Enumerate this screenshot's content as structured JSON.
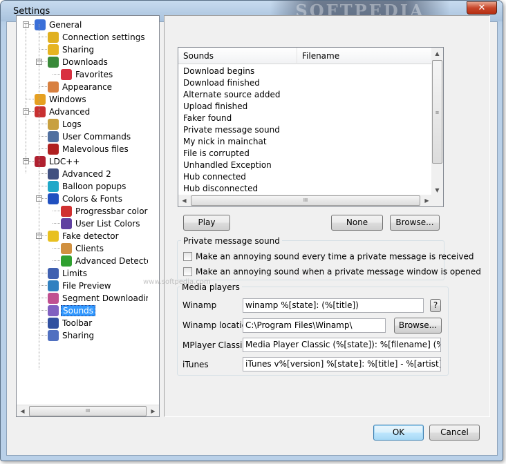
{
  "window": {
    "title": "Settings",
    "close_glyph": "✕",
    "watermark": "SOFTPEDIA"
  },
  "tree": {
    "items": [
      {
        "label": "General",
        "icon": "general-icon",
        "color": "#3a6fd8"
      },
      {
        "label": "Connection settings",
        "icon": "connection-icon",
        "color": "#e0b020"
      },
      {
        "label": "Sharing",
        "icon": "sharing-icon",
        "color": "#e6b422"
      },
      {
        "label": "Downloads",
        "icon": "downloads-icon",
        "color": "#3a8a3a"
      },
      {
        "label": "Favorites",
        "icon": "favorites-icon",
        "color": "#d83040"
      },
      {
        "label": "Appearance",
        "icon": "appearance-icon",
        "color": "#d88040"
      },
      {
        "label": "Windows",
        "icon": "windows-icon",
        "color": "#e6a020"
      },
      {
        "label": "Advanced",
        "icon": "advanced-icon",
        "color": "#c83030"
      },
      {
        "label": "Logs",
        "icon": "logs-icon",
        "color": "#c8a040"
      },
      {
        "label": "User Commands",
        "icon": "user-commands-icon",
        "color": "#5070a0"
      },
      {
        "label": "Malevolous files",
        "icon": "malevolous-files-icon",
        "color": "#b02020"
      },
      {
        "label": "LDC++",
        "icon": "ldc-icon",
        "color": "#b02030"
      },
      {
        "label": "Advanced 2",
        "icon": "advanced2-icon",
        "color": "#405080"
      },
      {
        "label": "Balloon popups",
        "icon": "balloon-icon",
        "color": "#20a8c8"
      },
      {
        "label": "Colors & Fonts",
        "icon": "colors-fonts-icon",
        "color": "#2050c0"
      },
      {
        "label": "Progressbar colors",
        "icon": "progressbar-icon",
        "color": "#d03030"
      },
      {
        "label": "User List Colors",
        "icon": "user-list-colors-icon",
        "color": "#6040a0"
      },
      {
        "label": "Fake detector",
        "icon": "warning-icon",
        "color": "#e8c020"
      },
      {
        "label": "Clients",
        "icon": "clients-icon",
        "color": "#d09040"
      },
      {
        "label": "Advanced Detector Pat",
        "icon": "detector-icon",
        "color": "#30a030"
      },
      {
        "label": "Limits",
        "icon": "limits-icon",
        "color": "#4060b0"
      },
      {
        "label": "File Preview",
        "icon": "file-preview-icon",
        "color": "#3080c0"
      },
      {
        "label": "Segment Downloading",
        "icon": "segment-icon",
        "color": "#c05090"
      },
      {
        "label": "Sounds",
        "icon": "sounds-icon",
        "color": "#8060c0"
      },
      {
        "label": "Toolbar",
        "icon": "toolbar-icon",
        "color": "#3050a0"
      },
      {
        "label": "Sharing",
        "icon": "sharing2-icon",
        "color": "#5070c0"
      }
    ],
    "selected": "Sounds",
    "scroll_grip": "III"
  },
  "sounds_list": {
    "columns": [
      "Sounds",
      "Filename"
    ],
    "rows": [
      "Download begins",
      "Download finished",
      "Alternate source added",
      "Upload finished",
      "Faker found",
      "Private message sound",
      "My nick in mainchat",
      "File is corrupted",
      "Unhandled Exception",
      "Hub connected",
      "Hub disconnected"
    ],
    "scroll_grip": "III"
  },
  "buttons": {
    "play": "Play",
    "none": "None",
    "browse": "Browse...",
    "browse_winamp": "Browse...",
    "help": "?",
    "ok": "OK",
    "cancel": "Cancel"
  },
  "pm_group": {
    "title": "Private message sound",
    "check1": "Make an annoying sound every time a private message is received",
    "check2": "Make an annoying sound when a private message window is opened"
  },
  "media_group": {
    "title": "Media players",
    "winamp_label": "Winamp",
    "winamp_value": "winamp %[state]: (%[title])",
    "winamp_location_label": "Winamp location",
    "winamp_location_value": "C:\\Program Files\\Winamp\\",
    "mplayer_label": "MPlayer Classic",
    "mplayer_value": "Media Player Classic (%[state]): %[filename] (%[size]) - %[elapsed]",
    "itunes_label": "iTunes",
    "itunes_value": "iTunes v%[version] %[state]: %[title] - %[artist] - %[album] (%[length])"
  },
  "watermark_mid": "www.softpedia.com"
}
